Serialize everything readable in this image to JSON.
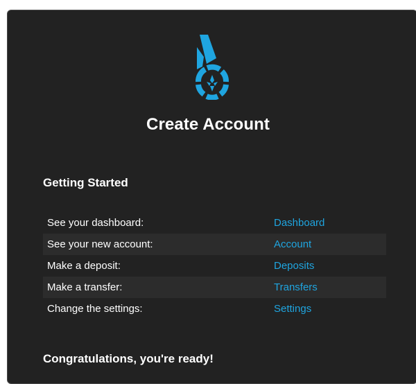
{
  "page": {
    "title": "Create Account"
  },
  "logo": {
    "icon": "bitshares-logo-icon",
    "color": "#1fa5e0"
  },
  "getting_started": {
    "heading": "Getting Started",
    "rows": [
      {
        "label": "See your dashboard:",
        "link": "Dashboard"
      },
      {
        "label": "See your new account:",
        "link": "Account"
      },
      {
        "label": "Make a deposit:",
        "link": "Deposits"
      },
      {
        "label": "Make a transfer:",
        "link": "Transfers"
      },
      {
        "label": "Change the settings:",
        "link": "Settings"
      }
    ]
  },
  "footer": {
    "message": "Congratulations, you're ready!"
  },
  "colors": {
    "background": "#222222",
    "accent": "#1fa5e0",
    "alt_row": "#2c2c2c"
  }
}
